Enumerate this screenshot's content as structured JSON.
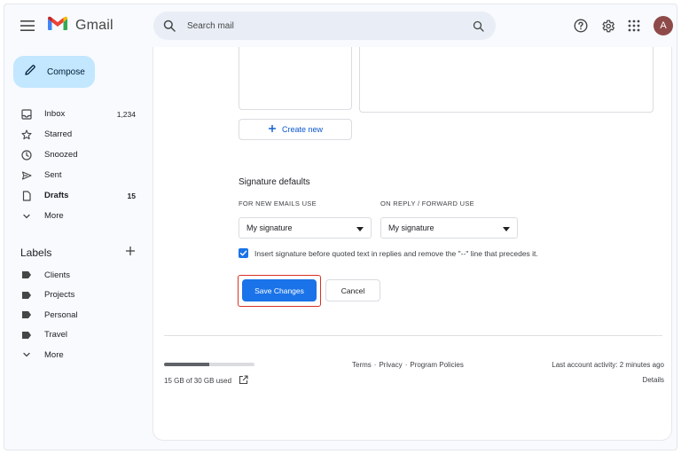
{
  "header": {
    "app_name": "Gmail",
    "search_placeholder": "Search mail",
    "avatar_initial": "A"
  },
  "sidebar": {
    "compose_label": "Compose",
    "items": [
      {
        "label": "Inbox",
        "count": "1,234",
        "icon": "inbox-icon"
      },
      {
        "label": "Starred",
        "count": "",
        "icon": "star-icon"
      },
      {
        "label": "Snoozed",
        "count": "",
        "icon": "clock-icon"
      },
      {
        "label": "Sent",
        "count": "",
        "icon": "send-icon"
      },
      {
        "label": "Drafts",
        "count": "15",
        "icon": "draft-icon"
      },
      {
        "label": "More",
        "count": "",
        "icon": "chevron-down-icon"
      }
    ],
    "labels_title": "Labels",
    "labels": [
      {
        "label": "Clients",
        "icon": "label-icon"
      },
      {
        "label": "Projects",
        "icon": "label-icon"
      },
      {
        "label": "Personal",
        "icon": "label-icon"
      },
      {
        "label": "Travel",
        "icon": "label-icon"
      },
      {
        "label": "More",
        "icon": "chevron-down-icon"
      }
    ]
  },
  "main": {
    "create_new_label": "Create new",
    "signature_defaults_title": "Signature defaults",
    "new_emails_label": "FOR NEW EMAILS USE",
    "new_emails_value": "My signature",
    "reply_forward_label": "ON REPLY / FORWARD USE",
    "reply_forward_value": "My signature",
    "insert_signature_text": "Insert signature before quoted text in replies and remove the \"--\" line that precedes it.",
    "insert_signature_checked": true,
    "save_label": "Save Changes",
    "cancel_label": "Cancel"
  },
  "footer": {
    "storage_text": "15 GB of 30 GB used",
    "storage_fraction": 0.5,
    "terms": "Terms",
    "privacy": "Privacy",
    "program_policies": "Program Policies",
    "separator": "·",
    "last_activity": "Last account activity: 2 minutes ago",
    "details": "Details"
  },
  "colors": {
    "accent": "#1a73e8",
    "compose_bg": "#c2e7ff",
    "highlight_outline": "#d93025"
  }
}
